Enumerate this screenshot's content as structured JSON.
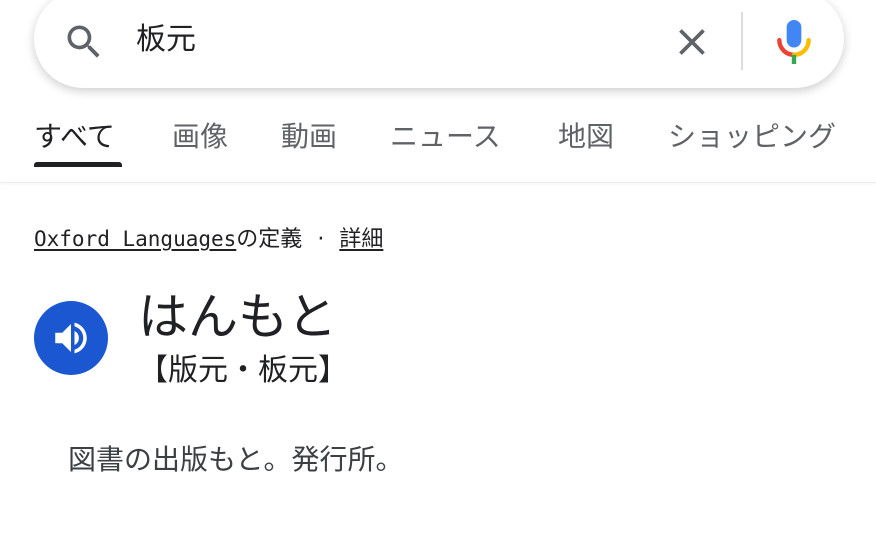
{
  "search": {
    "query": "板元"
  },
  "tabs": [
    {
      "label": "すべて",
      "active": true
    },
    {
      "label": "画像",
      "active": false
    },
    {
      "label": "動画",
      "active": false
    },
    {
      "label": "ニュース",
      "active": false
    },
    {
      "label": "地図",
      "active": false
    },
    {
      "label": "ショッピング",
      "active": false
    }
  ],
  "dictionary": {
    "source_name": "Oxford Languages",
    "source_suffix": "の定義",
    "separator": "·",
    "details_link": "詳細",
    "headword": "はんもと",
    "kanji": "【版元・板元】",
    "definition": "図書の出版もと。発行所。"
  },
  "icons": {
    "search": "search-icon",
    "clear": "close-icon",
    "mic": "mic-icon",
    "audio": "speaker-icon"
  },
  "colors": {
    "audio_button": "#1a57d1",
    "active_tab": "#202124",
    "inactive_tab": "#5f6368"
  }
}
